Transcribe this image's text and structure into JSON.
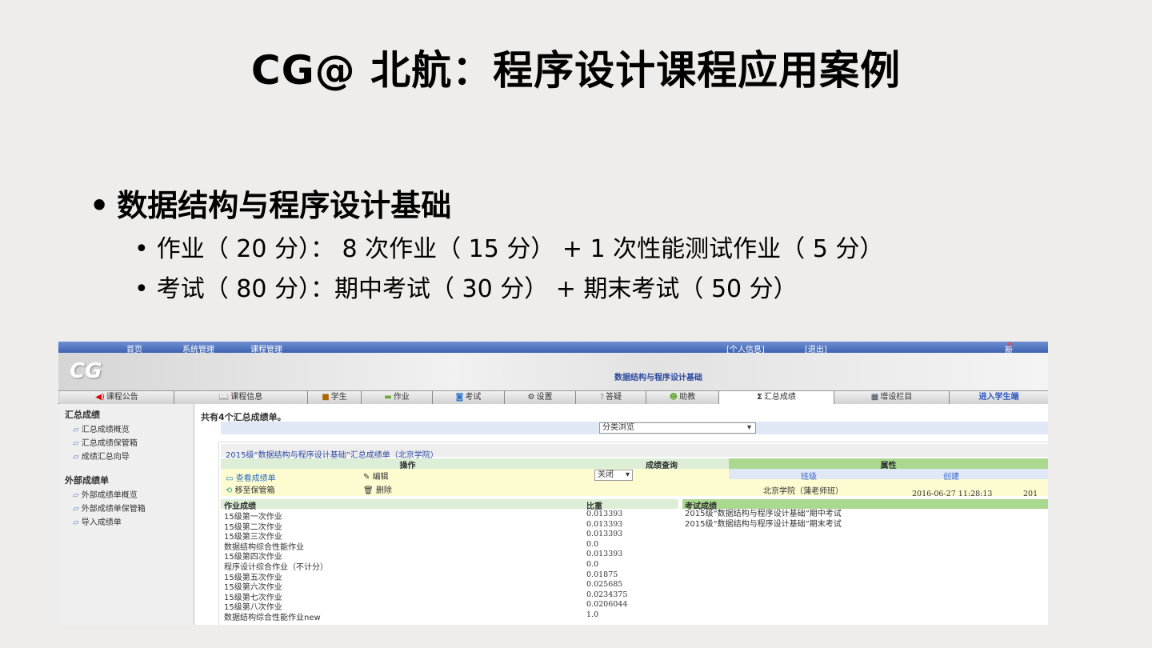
{
  "slide": {
    "title": "CG@ 北航：程序设计课程应用案例",
    "bullet": "数据结构与程序设计基础",
    "sub_bullets": [
      "作业（ 20 分）： 8 次作业（ 15 分） + 1 次性能测试作业（ 5 分）",
      "考试（ 80 分）：期中考试（ 30 分） +  期末考试（ 50 分）"
    ]
  },
  "app": {
    "topnav": [
      "首页",
      "系统管理",
      "课程管理"
    ],
    "user_links": [
      "[个人信息]",
      "[退出]"
    ],
    "help": "新手指南",
    "logo": "CG",
    "course_name": "数据结构与程序设计基础",
    "tabs": [
      {
        "label": "课程公告",
        "icon": "speaker-icon"
      },
      {
        "label": "课程信息",
        "icon": "book-icon"
      },
      {
        "label": "学生",
        "icon": "students-icon"
      },
      {
        "label": "作业",
        "icon": "homework-icon"
      },
      {
        "label": "考试",
        "icon": "exam-icon"
      },
      {
        "label": "设置",
        "icon": "gear-icon"
      },
      {
        "label": "答疑",
        "icon": "qa-icon"
      },
      {
        "label": "助教",
        "icon": "assistant-icon"
      },
      {
        "label": "汇总成绩",
        "icon": "sigma-icon"
      },
      {
        "label": "增设栏目",
        "icon": "grid-icon"
      },
      {
        "label": "进入学生端",
        "icon": ""
      }
    ],
    "sidebar": {
      "sections": [
        {
          "title": "汇总成绩",
          "items": [
            "汇总成绩概览",
            "汇总成绩保管箱",
            "成绩汇总向导"
          ]
        },
        {
          "title": "外部成绩单",
          "items": [
            "外部成绩单概览",
            "外部成绩单保管箱",
            "导入成绩单"
          ]
        }
      ]
    },
    "count_text": "共有4个汇总成绩单。",
    "filter_select": "分类浏览",
    "card": {
      "title": "2015级“数据结构与程序设计基础”汇总成绩单（北京学院）",
      "ops_header": "操作",
      "query_header": "成绩查询",
      "attr_header": "属性",
      "ops": [
        "查看成绩单",
        "编辑",
        "移至保管箱",
        "删除"
      ],
      "query_value": "关闭",
      "attr_cols": [
        "班级",
        "创建"
      ],
      "class_value": "北京学院（蒲老师班）",
      "created": "2016-06-27 11:28:13",
      "created_cut": "201",
      "hw_header": "作业成绩",
      "weight_header": "比重",
      "exam_header": "考试成绩",
      "homework": [
        [
          "15级第一次作业",
          "0.013393"
        ],
        [
          "15级第二次作业",
          "0.013393"
        ],
        [
          "15级第三次作业",
          "0.013393"
        ],
        [
          "数据结构综合性能作业",
          "0.0"
        ],
        [
          "15级第四次作业",
          "0.013393"
        ],
        [
          "程序设计综合作业（不计分）",
          "0.0"
        ],
        [
          "15级第五次作业",
          "0.01875"
        ],
        [
          "15级第六次作业",
          "0.025685"
        ],
        [
          "15级第七次作业",
          "0.0234375"
        ],
        [
          "15级第八次作业",
          "0.0206044"
        ],
        [
          "数据结构综合性能作业new",
          "1.0"
        ]
      ],
      "exams": [
        "2015级“数据结构与程序设计基础”期中考试",
        "2015级“数据结构与程序设计基础”期末考试"
      ]
    }
  }
}
